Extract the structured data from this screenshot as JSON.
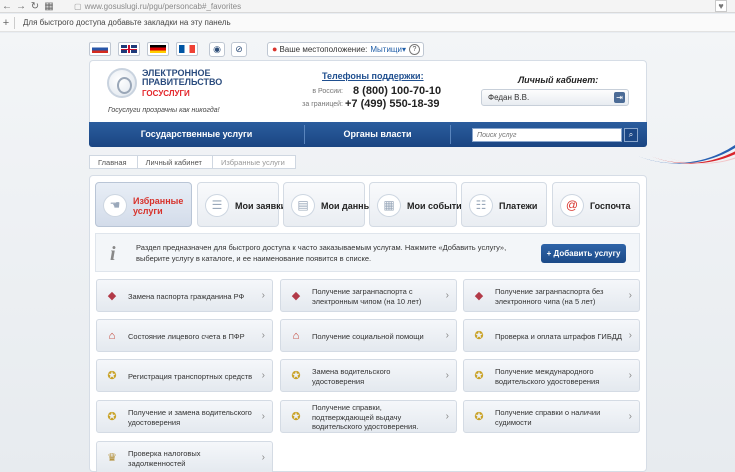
{
  "browser": {
    "url": "www.gosuslugi.ru/pgu/personcab#_favorites",
    "bookmarks_hint": "Для быстрого доступа добавьте закладки на эту панель"
  },
  "header": {
    "location_label": "Ваше местоположение:",
    "location_city": "Мытищи",
    "logo_title": "ЭЛЕКТРОННОЕ ПРАВИТЕЛЬСТВО",
    "logo_sub": "ГОСУСЛУГИ",
    "slogan": "Госуслуги прозрачны как никогда!",
    "phones_title": "Телефоны поддержки:",
    "phone_russia_label": "в России:",
    "phone_russia": "8 (800) 100-70-10",
    "phone_abroad_label": "за границей:",
    "phone_abroad": "+7 (499) 550-18-39",
    "cabinet_title": "Личный кабинет:",
    "cabinet_user": "Федан В.В."
  },
  "nav": {
    "services": "Государственные услуги",
    "authorities": "Органы власти",
    "search_placeholder": "Поиск услуг"
  },
  "breadcrumb": [
    "Главная",
    "Личный кабинет",
    "Избранные услуги"
  ],
  "tabs": [
    {
      "label": "Избранные услуги"
    },
    {
      "label": "Мои заявки"
    },
    {
      "label": "Мои данные"
    },
    {
      "label": "Мои события"
    },
    {
      "label": "Платежи"
    },
    {
      "label": "Госпочта"
    }
  ],
  "info": {
    "text": "Раздел предназначен для быстрого доступа к часто заказываемым услугам. Нажмите «Добавить услугу», выберите услугу в каталоге, и ее наименование появится в списке.",
    "add_button": "Добавить услугу"
  },
  "services": [
    {
      "label": "Замена паспорта гражданина РФ",
      "icon": "passport-icon"
    },
    {
      "label": "Получение загранпаспорта с электронным чипом (на 10 лет)",
      "icon": "passport-icon"
    },
    {
      "label": "Получение загранпаспорта без электронного чипа (на 5 лет)",
      "icon": "passport-icon"
    },
    {
      "label": "Состояние лицевого счета в ПФР",
      "icon": "pension-fund-icon"
    },
    {
      "label": "Получение социальной помощи",
      "icon": "pension-fund-icon"
    },
    {
      "label": "Проверка и оплата штрафов ГИБДД",
      "icon": "traffic-police-icon"
    },
    {
      "label": "Регистрация транспортных средств",
      "icon": "traffic-police-icon"
    },
    {
      "label": "Замена водительского удостоверения",
      "icon": "traffic-police-icon"
    },
    {
      "label": "Получение международного водительского удостоверения",
      "icon": "traffic-police-icon"
    },
    {
      "label": "Получение и замена водительского удостоверения",
      "icon": "traffic-police-icon"
    },
    {
      "label": "Получение справки, подтверждающей выдачу водительского удостоверения.",
      "icon": "traffic-police-icon"
    },
    {
      "label": "Получение справки о наличии судимости",
      "icon": "traffic-police-icon"
    },
    {
      "label": "Проверка налоговых задолженностей",
      "icon": "tax-service-icon"
    }
  ]
}
